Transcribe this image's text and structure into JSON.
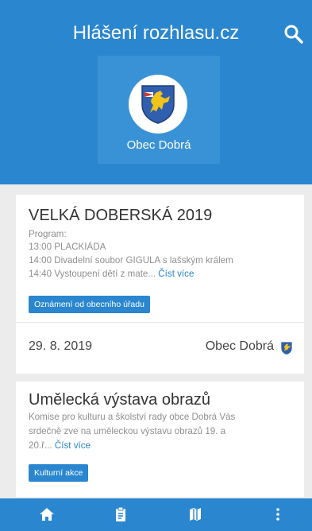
{
  "app": {
    "title": "Hlášení rozhlasu.cz"
  },
  "header": {
    "search_icon": "search-icon",
    "village": {
      "name": "Obec Dobrá",
      "crest_icon": "village-crest-icon"
    }
  },
  "colors": {
    "primary": "#2a86cf",
    "tile": "#3a92d6",
    "background": "#ececec"
  },
  "announcements": [
    {
      "title": "VELKÁ DOBERSKÁ 2019",
      "lines": [
        "Program:",
        "13:00 PLACKIÁDA",
        "14:00 Divadelní soubor GIGULA s lašským králem",
        "14:40 Vystoupení dětí z mate..."
      ],
      "read_more": "Číst více",
      "category": "Oznámení od obecního úřadu",
      "date": "29. 8. 2019",
      "source": "Obec Dobrá"
    },
    {
      "title": "Umělecká výstava obrazů",
      "lines": [
        "Komise pro kulturu a školství rady obce Dobrá Vás",
        "srdečně zve na uměleckou výstavu obrazů 19. a",
        "20.ř..."
      ],
      "read_more": "Číst více",
      "category": "Kulturní akce"
    }
  ],
  "bottom_nav": {
    "items": [
      {
        "icon": "home-icon"
      },
      {
        "icon": "clipboard-icon"
      },
      {
        "icon": "map-icon"
      },
      {
        "icon": "more-vertical-icon"
      }
    ]
  }
}
